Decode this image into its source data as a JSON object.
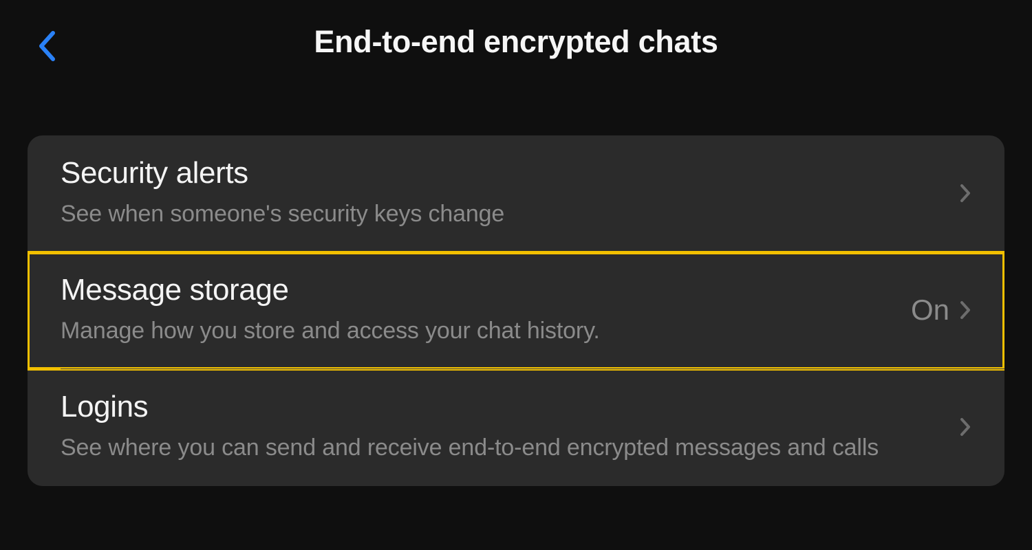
{
  "header": {
    "title": "End-to-end encrypted chats"
  },
  "items": [
    {
      "title": "Security alerts",
      "subtitle": "See when someone's security keys change",
      "value": "",
      "highlighted": false
    },
    {
      "title": "Message storage",
      "subtitle": "Manage how you store and access your chat history.",
      "value": "On",
      "highlighted": true
    },
    {
      "title": "Logins",
      "subtitle": "See where you can send and receive end-to-end encrypted messages and calls",
      "value": "",
      "highlighted": false
    }
  ]
}
